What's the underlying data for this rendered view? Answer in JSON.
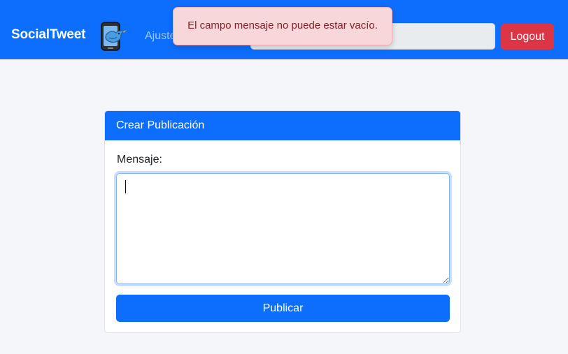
{
  "navbar": {
    "brand": "SocialTweet",
    "logo_icon": "phone-bird-logo",
    "links": [
      {
        "label": "Ajustes"
      }
    ],
    "search": {
      "value": "",
      "placeholder": ""
    },
    "logout_label": "Logout"
  },
  "toast": {
    "message": "El campo mensaje no puede estar vacío."
  },
  "card": {
    "title": "Crear Publicación",
    "field_label": "Mensaje:",
    "textarea": {
      "value": "",
      "placeholder": ""
    },
    "submit_label": "Publicar"
  },
  "colors": {
    "primary": "#0d6efd",
    "danger": "#dc3545",
    "toast_bg": "#f8d7da",
    "toast_text": "#842029",
    "page_bg": "#f4f6f9"
  }
}
